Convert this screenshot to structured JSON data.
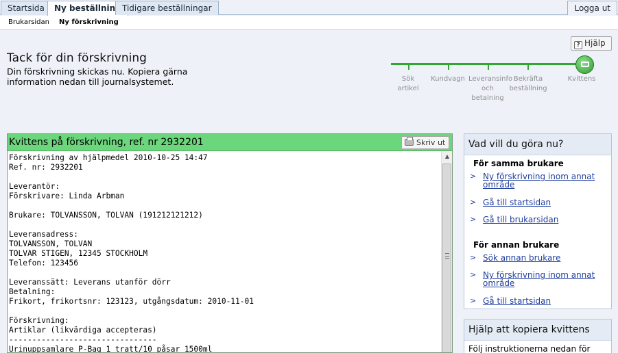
{
  "tabs": [
    {
      "label": "Startsida"
    },
    {
      "label": "Ny beställning"
    },
    {
      "label": "Tidigare beställningar"
    }
  ],
  "logout_label": "Logga ut",
  "subnav": [
    {
      "label": "Brukarsidan"
    },
    {
      "label": "Ny förskrivning"
    }
  ],
  "help_label": "Hjälp",
  "page_title": "Tack för din förskrivning",
  "intro": "Din förskrivning skickas nu. Kopiera gärna information nedan till journalsystemet.",
  "steps": [
    {
      "label": "Sök\nartikel"
    },
    {
      "label": "Kundvagn"
    },
    {
      "label": "Leveransinfo\noch\nbetalning"
    },
    {
      "label": "Bekräfta\nbeställning"
    },
    {
      "label": "Kvittens"
    }
  ],
  "receipt": {
    "title": "Kvittens på förskrivning, ref. nr 2932201",
    "print_label": "Skriv ut",
    "lines": "Förskrivning av hjälpmedel 2010-10-25 14:47\nRef. nr: 2932201\n\nLeverantör:\nFörskrivare: Linda Arbman\n\nBrukare: TOLVANSSON, TOLVAN (191212121212)\n\nLeveransadress:\nTOLVANSSON, TOLVAN\nTOLVAR STIGEN, 12345 STOCKHOLM\nTelefon: 123456\n\nLeveranssätt: Leverans utanför dörr\nBetalning:\nFrikort, frikortsnr: 123123, utgångsdatum: 2010-11-01\n\nFörskrivning:\nArtiklar (likvärdiga accepteras)\n--------------------------------\nUrinuppsamlare P-Bag 1 tratt/10 påsar 1500ml"
  },
  "sidebar": {
    "what_next": {
      "title": "Vad vill du göra nu?",
      "same_user_heading": "För samma brukare",
      "same_user_links": [
        {
          "label": "Ny förskrivning inom annat område"
        },
        {
          "label": "Gå till startsidan"
        },
        {
          "label": "Gå till brukarsidan"
        }
      ],
      "other_user_heading": "För annan brukare",
      "other_user_links": [
        {
          "label": "Sök annan brukare"
        },
        {
          "label": "Ny förskrivning inom annat område"
        },
        {
          "label": "Gå till startsidan"
        }
      ]
    },
    "copy_help": {
      "title": "Hjälp att kopiera kvittens",
      "text": "Följ instruktionerna nedan för"
    }
  },
  "colors": {
    "progress_green": "#2ea82e",
    "receipt_header": "#6cd67c",
    "link_blue": "#1f3f9f"
  }
}
